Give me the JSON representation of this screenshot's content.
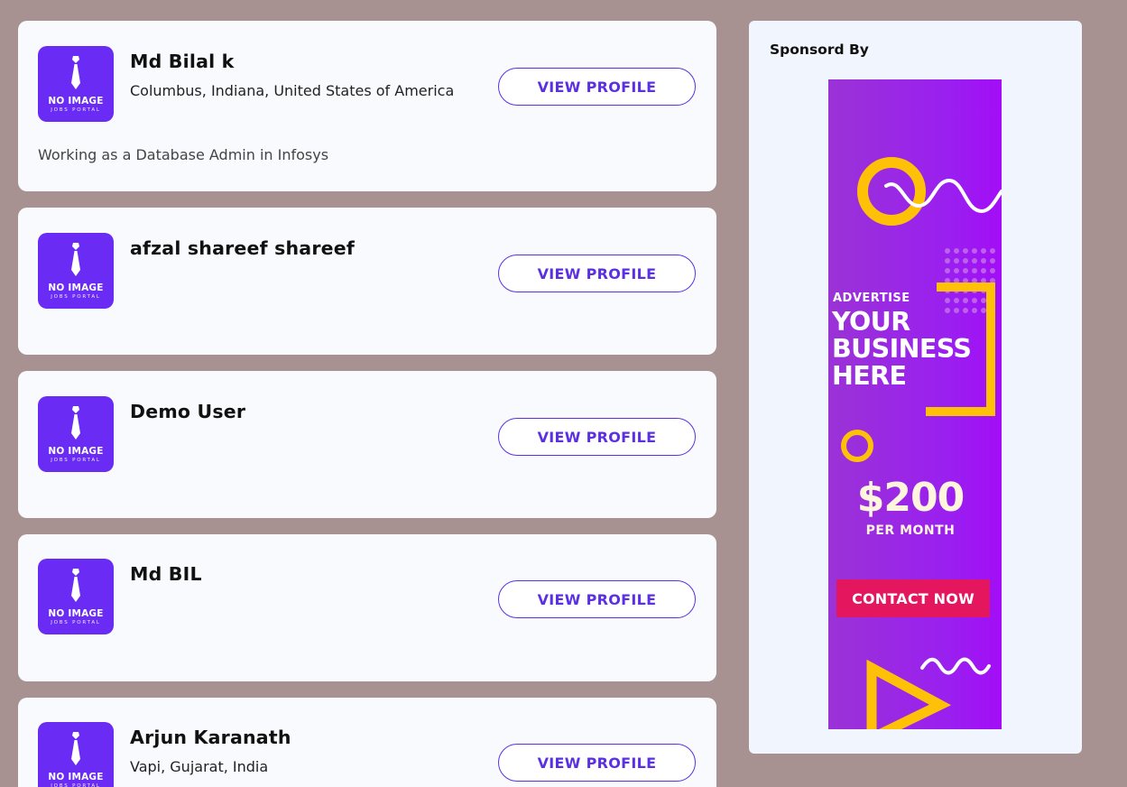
{
  "profiles": [
    {
      "name": "Md Bilal k",
      "location": "Columbus, Indiana, United States of America",
      "description": "Working as a Database Admin in Infosys",
      "button": "VIEW PROFILE"
    },
    {
      "name": "afzal shareef shareef",
      "location": "",
      "description": "",
      "button": "VIEW PROFILE"
    },
    {
      "name": "Demo User",
      "location": "",
      "description": "",
      "button": "VIEW PROFILE"
    },
    {
      "name": "Md BIL",
      "location": "",
      "description": "",
      "button": "VIEW PROFILE"
    },
    {
      "name": "Arjun Karanath",
      "location": "Vapi, Gujarat, India",
      "description": "",
      "button": "VIEW PROFILE"
    }
  ],
  "placeholder_logo": {
    "line1": "NO IMAGE",
    "line2": "JOBS PORTAL",
    "icon": "tie-icon"
  },
  "sidebar": {
    "title": "Sponsord By",
    "ad": {
      "kicker": "ADVERTISE",
      "headline_1": "YOUR",
      "headline_2": "BUSINESS",
      "headline_3": "HERE",
      "price": "$200",
      "price_unit": "PER MONTH",
      "cta": "CONTACT NOW"
    }
  },
  "colors": {
    "background": "#a89191",
    "card": "#f9fafd",
    "accent": "#5b30e3",
    "logo_bg": "#6a2cf5",
    "ad_yellow": "#ffc107",
    "ad_cta": "#e3165e"
  }
}
